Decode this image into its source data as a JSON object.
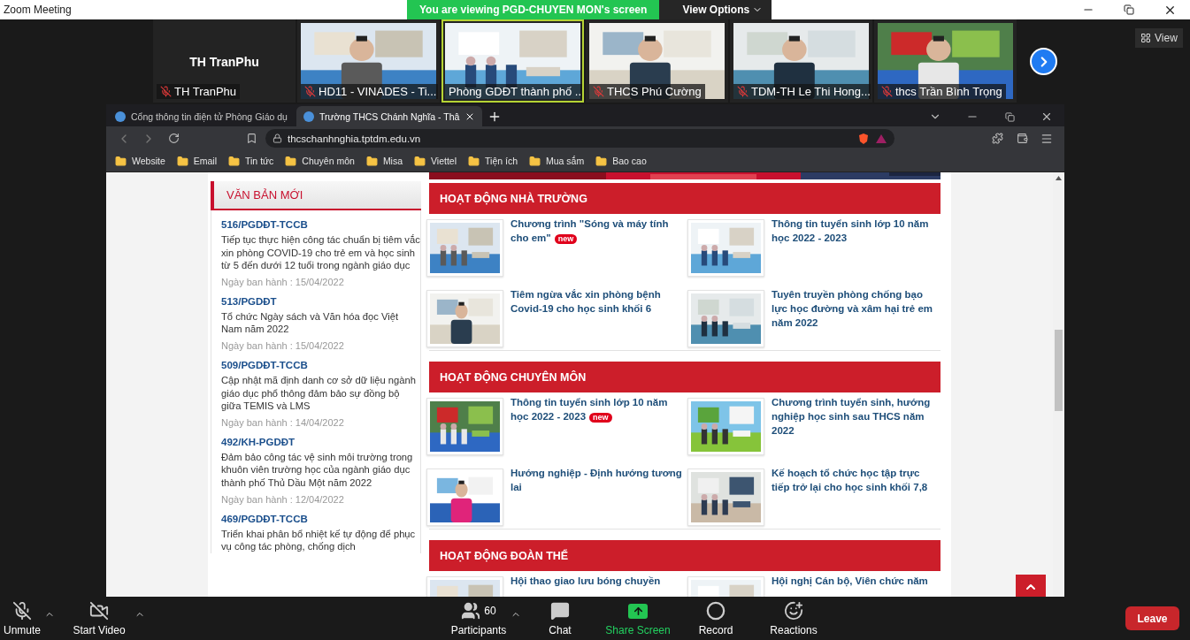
{
  "window": {
    "title": "Zoom Meeting",
    "banner": "You are viewing PGD-CHUYEN MON's screen",
    "view_options": "View Options"
  },
  "gallery": {
    "tiles": [
      {
        "kind": "name",
        "display_name": "TH TranPhu",
        "name": "TH TranPhu",
        "muted": true,
        "speaking": false
      },
      {
        "kind": "video",
        "name": "HD11 - VINADES - Ti...",
        "muted": true,
        "speaking": false
      },
      {
        "kind": "video",
        "name": "Phòng GDĐT thành phố ...",
        "muted": false,
        "speaking": true
      },
      {
        "kind": "video",
        "name": "THCS Phú Cường",
        "muted": true,
        "speaking": false
      },
      {
        "kind": "video",
        "name": "TDM-TH Le Thi Hong...",
        "muted": true,
        "speaking": false
      },
      {
        "kind": "video",
        "name": "thcs Trần Bình Trọng",
        "muted": true,
        "speaking": false
      }
    ],
    "view_button": "View"
  },
  "browser": {
    "tabs": [
      {
        "title": "Cổng thông tin điện tử Phòng Giáo dụ",
        "selected": false
      },
      {
        "title": "Trường THCS Chánh Nghĩa - Thâ",
        "selected": true
      }
    ],
    "url": "thcschanhnghia.tptdm.edu.vn",
    "bookmarks": [
      "Website",
      "Email",
      "Tin tức",
      "Chuyên môn",
      "Misa",
      "Viettel",
      "Tiện ích",
      "Mua sắm",
      "Bao cao"
    ]
  },
  "page": {
    "sidebar": {
      "heading": "VĂN BẢN MỚI",
      "documents": [
        {
          "code": "516/PGDĐT-TCCB",
          "title": "Tiếp tục thực hiện công tác chuẩn bị tiêm vắc xin phòng COVID-19 cho trẻ em và học sinh từ 5 đến dưới 12 tuổi trong ngành giáo dục",
          "date": "Ngày ban hành : 15/04/2022"
        },
        {
          "code": "513/PGDĐT",
          "title": "Tổ chức Ngày sách và Văn hóa đọc Việt Nam năm 2022",
          "date": "Ngày ban hành : 15/04/2022"
        },
        {
          "code": "509/PGDĐT-TCCB",
          "title": "Cập nhật mã định danh cơ sở dữ liệu ngành giáo dục phổ thông đảm bảo sự đồng bộ giữa TEMIS và LMS",
          "date": "Ngày ban hành : 14/04/2022"
        },
        {
          "code": "492/KH-PGDĐT",
          "title": "Đảm bảo công tác vệ sinh môi trường trong khuôn viên trường học của ngành giáo dục thành phố Thủ Dầu Một năm 2022",
          "date": "Ngày ban hành : 12/04/2022"
        },
        {
          "code": "469/PGDĐT-TCCB",
          "title": "Triển khai phân bổ nhiệt kế tự động để phục vụ công tác phòng, chống dịch"
        }
      ]
    },
    "sections": [
      {
        "heading": "HOẠT ĐỘNG NHÀ TRƯỜNG",
        "articles": [
          {
            "title": "Chương trình \"Sóng và máy tính cho em\"",
            "badge": "new"
          },
          {
            "title": "Thông tin tuyển sinh lớp 10 năm học 2022 - 2023"
          },
          {
            "title": "Tiêm ngừa vắc xin phòng bệnh Covid-19 cho học sinh khối 6"
          },
          {
            "title": "Tuyên truyền phòng chống bạo lực học đường và xâm hại trẻ em năm 2022"
          }
        ]
      },
      {
        "heading": "HOẠT ĐỘNG CHUYÊN MÔN",
        "articles": [
          {
            "title": "Thông tin tuyển sinh lớp 10 năm học 2022 - 2023",
            "badge": "new"
          },
          {
            "title": "Chương trình tuyển sinh, hướng nghiệp học sinh sau THCS năm 2022"
          },
          {
            "title": "Hướng nghiệp - Định hướng tương lai"
          },
          {
            "title": "Kế hoạch tổ chức học tập trực tiếp trở lại cho học sinh khối 7,8"
          }
        ]
      },
      {
        "heading": "HOẠT ĐỘNG ĐOÀN THỂ",
        "articles": [
          {
            "title": "Hội thao giao lưu bóng chuyền"
          },
          {
            "title": "Hội nghị Cán bộ, Viên chức năm"
          }
        ]
      }
    ]
  },
  "toolbar": {
    "left": [
      {
        "kind": "mic",
        "label": "Unmute",
        "muted": true
      },
      {
        "kind": "video",
        "label": "Start Video",
        "muted": true
      }
    ],
    "center": [
      {
        "kind": "participants",
        "label": "Participants",
        "count": "60"
      },
      {
        "kind": "chat",
        "label": "Chat"
      },
      {
        "kind": "share",
        "label": "Share Screen"
      },
      {
        "kind": "record",
        "label": "Record"
      },
      {
        "kind": "reactions",
        "label": "Reactions"
      }
    ],
    "leave": "Leave"
  }
}
